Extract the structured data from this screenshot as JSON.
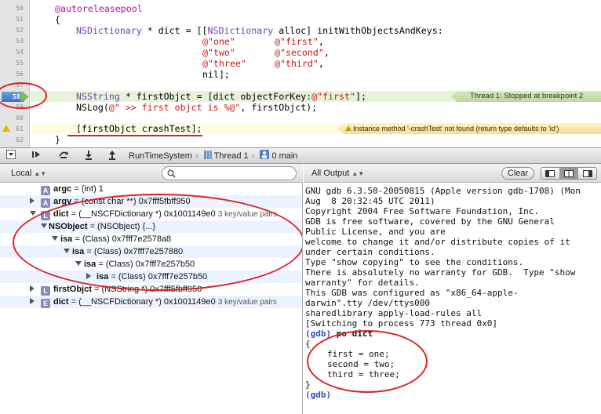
{
  "editor": {
    "line_numbers": [
      "50",
      "51",
      "52",
      "53",
      "54",
      "55",
      "56",
      "57",
      "58",
      "59",
      "60",
      "61",
      "62"
    ],
    "code": {
      "l50_kw": "@autoreleasepool",
      "l51": "{",
      "l52_cls": "NSDictionary",
      "l52_mid": " * dict = [[",
      "l52_cls2": "NSDictionary",
      "l52_rest": " alloc] initWithObjectsAndKeys:",
      "l53_a": "@\"one\"",
      "l53_b": "@\"first\"",
      "l54_a": "@\"two\"",
      "l54_b": "@\"second\"",
      "l55_a": "@\"three\"",
      "l55_b": "@\"third\"",
      "l56": "nil];",
      "l58_cls": "NSString",
      "l58_mid": " * firstObjct = [dict objectForKey:",
      "l58_str": "@\"first\"",
      "l58_end": "];",
      "l59_a": "NSLog(",
      "l59_str": "@\" >> first objct is %@\"",
      "l59_b": ", firstObjct);",
      "l61": "[firstObjct crashTest];",
      "l62": "}"
    },
    "breakpoint_line": "58",
    "thread_label": "Thread 1: Stopped at breakpoint 2",
    "warning_label": "Instance method '-crashTest' not found (return type defaults to 'id')"
  },
  "debugbar": {
    "crumbs": [
      "RunTimeSystem",
      "Thread 1",
      "0 main"
    ]
  },
  "variables": {
    "scope_label": "Local",
    "search_placeholder": "",
    "rows": [
      {
        "badge": "A",
        "name": "argc",
        "value": "= (int) 1"
      },
      {
        "badge": "A",
        "name": "argv",
        "value": "= (const char **) 0x7fff5fbff950"
      },
      {
        "badge": "L",
        "name": "dict",
        "value": "= (__NSCFDictionary *) 0x1001149e0",
        "summary": "3 key/value pairs"
      },
      {
        "name": "NSObject",
        "value": "= (NSObject) {...}"
      },
      {
        "name": "isa",
        "value": "= (Class) 0x7fff7e2578a8"
      },
      {
        "name": "isa",
        "value": "= (Class) 0x7fff7e257880"
      },
      {
        "name": "isa",
        "value": "= (Class) 0x7fff7e257b50"
      },
      {
        "name": "isa",
        "value": "= (Class) 0x7fff7e257b50"
      },
      {
        "badge": "L",
        "name": "firstObjct",
        "value": "= (NSString *) 0x7fff5fbff950"
      },
      {
        "badge": "E",
        "name": "dict",
        "value": "= (__NSCFDictionary *) 0x1001149e0",
        "summary": "3 key/value pairs"
      }
    ]
  },
  "console": {
    "filter_label": "All Output",
    "clear_label": "Clear",
    "lines": [
      "GNU gdb 6.3.50-20050815 (Apple version gdb-1708) (Mon",
      "Aug  8 20:32:45 UTC 2011)",
      "Copyright 2004 Free Software Foundation, Inc.",
      "GDB is free software, covered by the GNU General",
      "Public License, and you are",
      "welcome to change it and/or distribute copies of it",
      "under certain conditions.",
      "Type \"show copying\" to see the conditions.",
      "There is absolutely no warranty for GDB.  Type \"show",
      "warranty\" for details.",
      "This GDB was configured as \"x86_64-apple-",
      "darwin\".tty /dev/ttys000",
      "sharedlibrary apply-load-rules all",
      "[Switching to process 773 thread 0x0]"
    ],
    "prompt": "(gdb)",
    "command": "po dict",
    "dict_open": "{",
    "dict_lines": [
      "first = one;",
      "second = two;",
      "third = three;"
    ],
    "dict_close": "}",
    "final_prompt": "(gdb)"
  },
  "colors": {
    "annotation": "#d9232a",
    "keyword": "#b0109a",
    "string": "#c41a16",
    "class": "#6f3fa8"
  }
}
